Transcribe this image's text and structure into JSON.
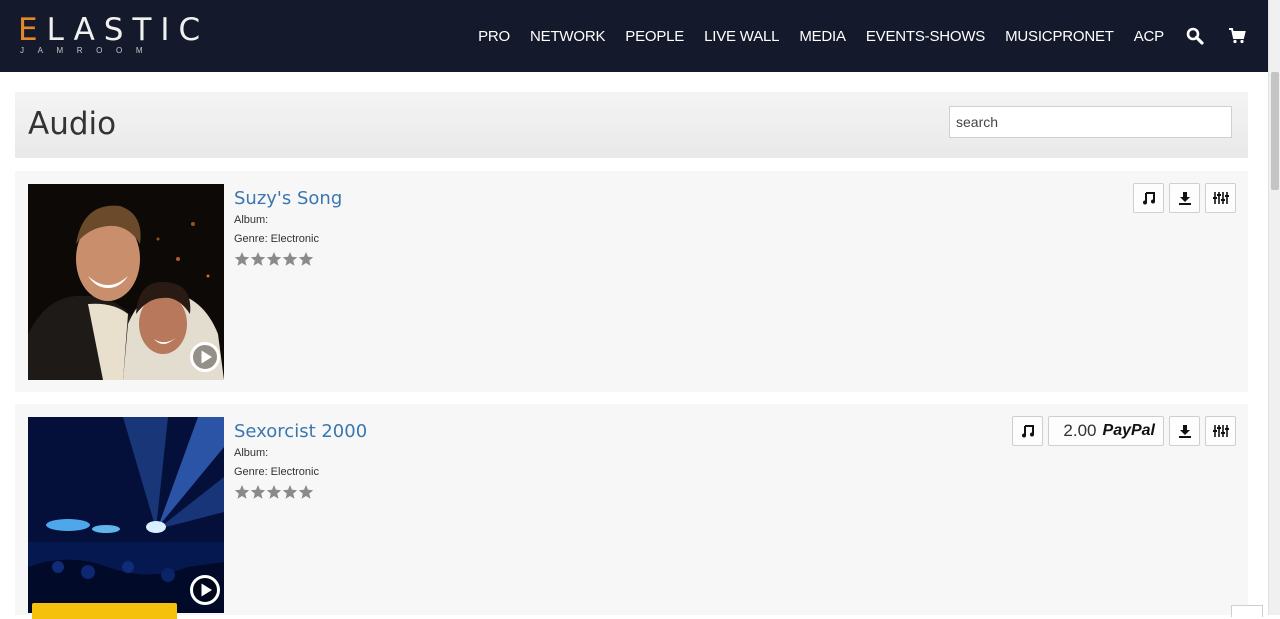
{
  "logo": {
    "main_first": "E",
    "main_rest": "LASTIC",
    "sub": "JAMROOM"
  },
  "nav": {
    "items": [
      "PRO",
      "NETWORK",
      "PEOPLE",
      "LIVE WALL",
      "MEDIA",
      "EVENTS-SHOWS",
      "MUSICPRONET",
      "ACP"
    ],
    "search_icon": "search-icon",
    "cart_icon": "cart-icon"
  },
  "page": {
    "title": "Audio",
    "search_placeholder": "search"
  },
  "items": [
    {
      "title": "Suzy's Song",
      "album": "Album:",
      "genre": "Genre: Electronic",
      "rating_stars": 5,
      "actions": [
        "music-note-icon",
        "download-icon",
        "mixer-icon"
      ]
    },
    {
      "title": "Sexorcist 2000",
      "album": "Album:",
      "genre": "Genre: Electronic",
      "rating_stars": 5,
      "price": "2.00",
      "price_provider": "PayPal",
      "actions": [
        "music-note-icon",
        "paypal-button",
        "download-icon",
        "mixer-icon"
      ]
    }
  ],
  "colors": {
    "nav_bg": "#141a2b",
    "logo_accent": "#e8862a",
    "link": "#3a77b0",
    "star": "#8a8a8a",
    "highlight": "#f6c10a"
  }
}
